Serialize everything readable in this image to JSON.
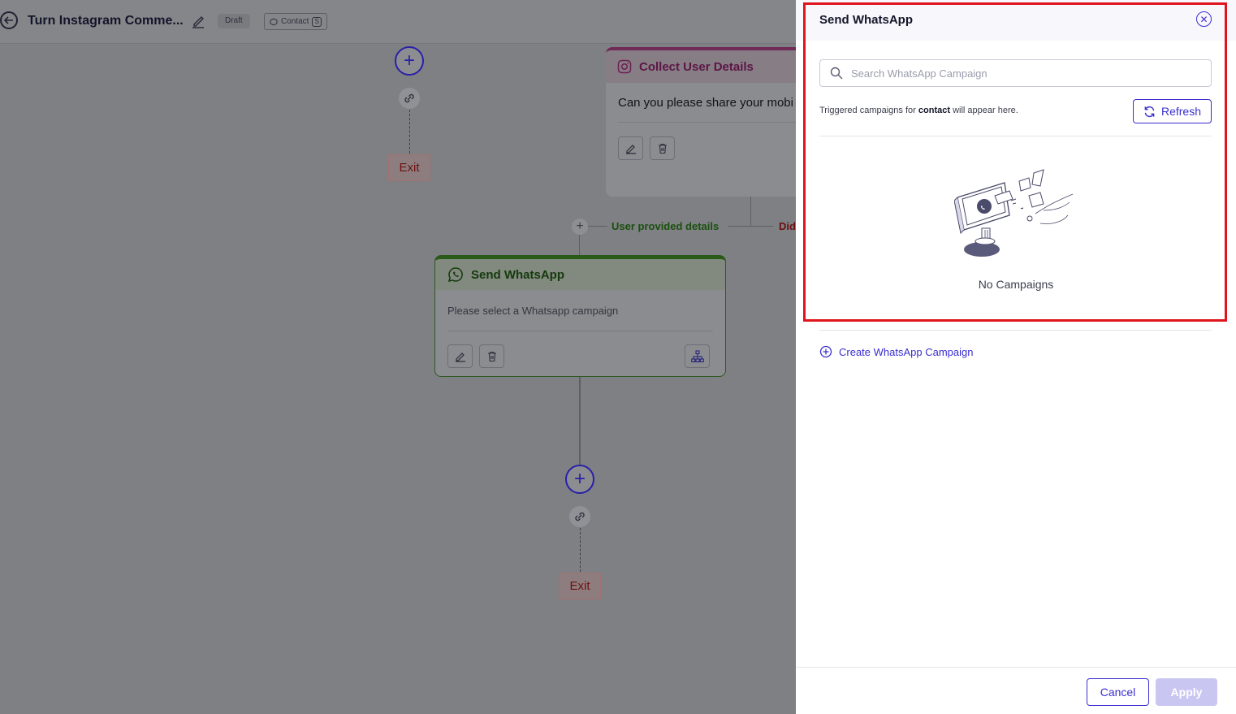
{
  "header": {
    "title": "Turn Instagram Comme...",
    "status_badge": "Draft",
    "contact_badge": "Contact",
    "contact_suffix": "S"
  },
  "canvas": {
    "exit_label_top": "Exit",
    "exit_label_bottom": "Exit",
    "collect_node": {
      "title": "Collect User Details",
      "message": "Can you please share your mobi"
    },
    "branches": {
      "provided": "User provided details",
      "not_provided": "Did"
    },
    "whatsapp_node": {
      "title": "Send WhatsApp",
      "message": "Please select a Whatsapp campaign"
    }
  },
  "drawer": {
    "title": "Send WhatsApp",
    "search_placeholder": "Search WhatsApp Campaign",
    "note_prefix": "Triggered campaigns for",
    "note_entity": "contact",
    "note_suffix": "will appear here.",
    "refresh_label": "Refresh",
    "empty_text": "No Campaigns",
    "create_label": "Create WhatsApp Campaign",
    "cancel_label": "Cancel",
    "apply_label": "Apply"
  },
  "colors": {
    "accent": "#3a2fd0",
    "highlight": "#e0141c",
    "whatsapp_green": "#2a5a18",
    "instagram_pink": "#d6287f"
  }
}
